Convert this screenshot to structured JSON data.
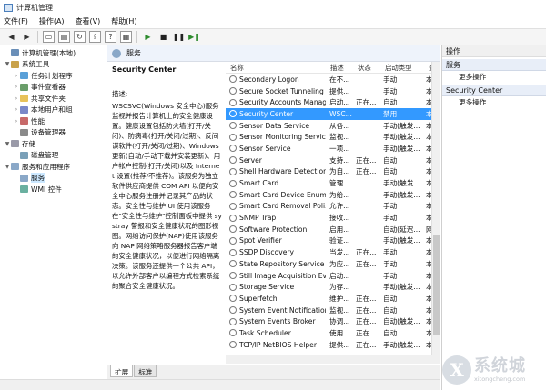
{
  "window": {
    "title": "计算机管理"
  },
  "menu": [
    "文件(F)",
    "操作(A)",
    "查看(V)",
    "帮助(H)"
  ],
  "tree": [
    {
      "label": "计算机管理(本地)",
      "expander": "",
      "icon": "computer-icon",
      "cls": "ico-comp",
      "indent": 4,
      "selected": false
    },
    {
      "label": "系统工具",
      "expander": "▼",
      "icon": "tools-icon",
      "cls": "ico-tool",
      "indent": 4,
      "selected": false
    },
    {
      "label": "任务计划程序",
      "expander": "›",
      "icon": "clock-icon",
      "cls": "ico-clock",
      "indent": 14,
      "selected": false
    },
    {
      "label": "事件查看器",
      "expander": "›",
      "icon": "event-viewer-icon",
      "cls": "ico-ev",
      "indent": 14,
      "selected": false
    },
    {
      "label": "共享文件夹",
      "expander": "›",
      "icon": "shared-folder-icon",
      "cls": "ico-folder",
      "indent": 14,
      "selected": false
    },
    {
      "label": "本地用户和组",
      "expander": "›",
      "icon": "users-icon",
      "cls": "ico-users",
      "indent": 14,
      "selected": false
    },
    {
      "label": "性能",
      "expander": "›",
      "icon": "performance-icon",
      "cls": "ico-perf",
      "indent": 14,
      "selected": false
    },
    {
      "label": "设备管理器",
      "expander": "",
      "icon": "device-manager-icon",
      "cls": "ico-dev",
      "indent": 14,
      "selected": false
    },
    {
      "label": "存储",
      "expander": "▼",
      "icon": "storage-icon",
      "cls": "ico-store",
      "indent": 4,
      "selected": false
    },
    {
      "label": "磁盘管理",
      "expander": "",
      "icon": "disk-icon",
      "cls": "ico-disk",
      "indent": 14,
      "selected": false
    },
    {
      "label": "服务和应用程序",
      "expander": "▼",
      "icon": "services-apps-icon",
      "cls": "ico-svc",
      "indent": 4,
      "selected": false
    },
    {
      "label": "服务",
      "expander": "",
      "icon": "services-icon",
      "cls": "ico-svc",
      "indent": 14,
      "selected": true
    },
    {
      "label": "WMI 控件",
      "expander": "",
      "icon": "wmi-icon",
      "cls": "ico-wmi",
      "indent": 14,
      "selected": false
    }
  ],
  "center": {
    "header": "服务"
  },
  "description": {
    "service_name": "Security Center",
    "label": "描述:",
    "text": "WSCSVC(Windows 安全中心)服务监视并报告计算机上的安全健康设置。健康设置包括防火墙(打开/关闭)、防病毒(打开/关闭/过期)、反间谍软件(打开/关闭/过期)、Windows 更新(自动/手动下载并安装更新)、用户帐户控制(打开/关闭)以及 Internet 设置(推荐/不推荐)。该服务为独立软件供应商提供 COM API 以便向安全中心服务注册并记录其产品的状态。安全性与维护 UI 使用该服务在\"安全性与维护\"控制面板中提供 systray 警报和安全健康状况的图形视图。网络访问保护(NAP)使用该服务向 NAP 网络策略服务器报告客户端的安全健康状况，以便进行网络隔离决策。该服务还提供一个公共 API，以允许外部客户以编程方式检索系统的聚合安全健康状况。"
  },
  "table": {
    "columns": [
      "名称",
      "描述",
      "状态",
      "启动类型",
      "登"
    ],
    "rows": [
      {
        "name": "Secondary Logon",
        "desc": "在不...",
        "status": "",
        "start": "手动",
        "login": "本"
      },
      {
        "name": "Secure Socket Tunneling ...",
        "desc": "提供...",
        "status": "",
        "start": "手动",
        "login": "本"
      },
      {
        "name": "Security Accounts Manag...",
        "desc": "启动...",
        "status": "正在...",
        "start": "自动",
        "login": "本"
      },
      {
        "name": "Security Center",
        "desc": "WSC...",
        "status": "",
        "start": "禁用",
        "login": "本"
      },
      {
        "name": "Sensor Data Service",
        "desc": "从各...",
        "status": "",
        "start": "手动(触发...",
        "login": "本"
      },
      {
        "name": "Sensor Monitoring Service",
        "desc": "监视...",
        "status": "",
        "start": "手动(触发...",
        "login": "本"
      },
      {
        "name": "Sensor Service",
        "desc": "一项...",
        "status": "",
        "start": "手动(触发...",
        "login": "本"
      },
      {
        "name": "Server",
        "desc": "支持...",
        "status": "正在...",
        "start": "自动",
        "login": "本"
      },
      {
        "name": "Shell Hardware Detection",
        "desc": "为自...",
        "status": "正在...",
        "start": "自动",
        "login": "本"
      },
      {
        "name": "Smart Card",
        "desc": "管理...",
        "status": "",
        "start": "手动(触发...",
        "login": "本"
      },
      {
        "name": "Smart Card Device Enum...",
        "desc": "为给...",
        "status": "",
        "start": "手动(触发...",
        "login": "本"
      },
      {
        "name": "Smart Card Removal Poli...",
        "desc": "允许...",
        "status": "",
        "start": "手动",
        "login": "本"
      },
      {
        "name": "SNMP Trap",
        "desc": "接收...",
        "status": "",
        "start": "手动",
        "login": "本"
      },
      {
        "name": "Software Protection",
        "desc": "启用...",
        "status": "",
        "start": "自动(延迟...",
        "login": "网"
      },
      {
        "name": "Spot Verifier",
        "desc": "验证...",
        "status": "",
        "start": "手动(触发...",
        "login": "本"
      },
      {
        "name": "SSDP Discovery",
        "desc": "当发...",
        "status": "正在...",
        "start": "手动",
        "login": "本"
      },
      {
        "name": "State Repository Service",
        "desc": "为应...",
        "status": "正在...",
        "start": "手动",
        "login": "本"
      },
      {
        "name": "Still Image Acquisition Ev...",
        "desc": "启动...",
        "status": "",
        "start": "手动",
        "login": "本"
      },
      {
        "name": "Storage Service",
        "desc": "为存...",
        "status": "",
        "start": "手动(触发...",
        "login": "本"
      },
      {
        "name": "Superfetch",
        "desc": "维护...",
        "status": "正在...",
        "start": "自动",
        "login": "本"
      },
      {
        "name": "System Event Notification...",
        "desc": "监视...",
        "status": "正在...",
        "start": "自动",
        "login": "本"
      },
      {
        "name": "System Events Broker",
        "desc": "协调...",
        "status": "正在...",
        "start": "自动(触发...",
        "login": "本"
      },
      {
        "name": "Task Scheduler",
        "desc": "使用...",
        "status": "正在...",
        "start": "自动",
        "login": "本"
      },
      {
        "name": "TCP/IP NetBIOS Helper",
        "desc": "提供...",
        "status": "正在...",
        "start": "手动(触发...",
        "login": "本"
      }
    ],
    "selected_index": 3
  },
  "tabs": [
    "扩展",
    "标准"
  ],
  "actions": {
    "title": "操作",
    "groups": [
      {
        "label": "服务",
        "item": "更多操作"
      },
      {
        "label": "Security Center",
        "item": "更多操作"
      }
    ]
  },
  "watermark": {
    "logo_letter": "X",
    "text": "系统城",
    "url": "xitongcheng.com"
  }
}
